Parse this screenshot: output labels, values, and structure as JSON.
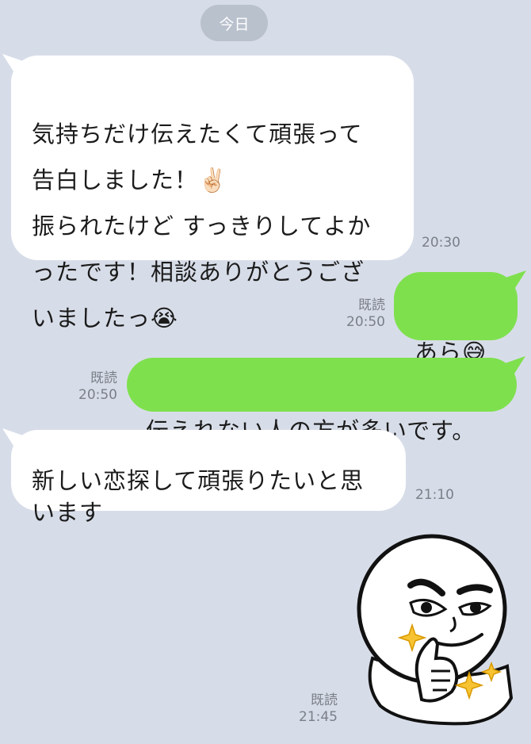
{
  "date_chip": "今日",
  "messages": [
    {
      "side": "in",
      "text": "気持ちだけ伝えたくて頑張って\n告白しました！✌🏻\n振られたけど すっきりしてよか\nったです！相談ありがとうござ\nいましたっ😭",
      "time": "20:30"
    },
    {
      "side": "out",
      "text": "あら😅",
      "read": "既読",
      "time": "20:50"
    },
    {
      "side": "out",
      "text": "伝えれない人の方が多いです。",
      "read": "既読",
      "time": "20:50"
    },
    {
      "side": "in",
      "text": "新しい恋探して頑張りたいと思\nいます",
      "time": "21:10"
    },
    {
      "side": "out",
      "sticker": "thumbs-up-smirk-face-sticker",
      "read": "既読",
      "time": "21:45"
    }
  ],
  "colors": {
    "background": "#d7dde8",
    "incoming_bubble": "#ffffff",
    "outgoing_bubble": "#7fe04e",
    "date_chip": "#b9c1cd",
    "meta_text": "#7a7f88"
  }
}
